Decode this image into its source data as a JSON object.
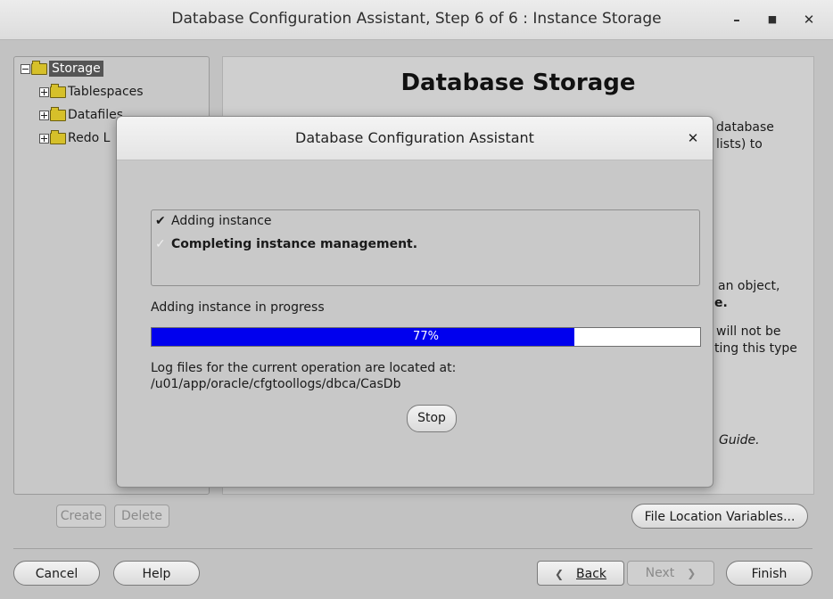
{
  "window": {
    "title": "Database Configuration Assistant, Step 6 of 6 : Instance Storage",
    "minimize": "–",
    "maximize": "■",
    "close": "✕"
  },
  "tree": {
    "root": "Storage",
    "items": [
      "Tablespaces",
      "Datafiles",
      "Redo L"
    ]
  },
  "content": {
    "heading": "Database Storage",
    "fragments": [
      "database",
      "lists) to",
      "an object,",
      "e.",
      "will not be",
      "ting this type",
      "Guide."
    ]
  },
  "tree_buttons": {
    "create": "Create",
    "delete": "Delete"
  },
  "file_location_button": "File Location Variables...",
  "footer": {
    "cancel": "Cancel",
    "help": "Help",
    "back": "Back",
    "next": "Next",
    "finish": "Finish",
    "back_icon": "chevron-left-icon",
    "next_icon": "chevron-right-icon"
  },
  "dialog": {
    "title": "Database Configuration Assistant",
    "close": "✕",
    "steps": [
      {
        "mark": "✔",
        "label": "Adding instance",
        "status": "done"
      },
      {
        "mark": "✓",
        "label": "Completing instance management.",
        "status": "in-progress"
      }
    ],
    "progress_label": "Adding instance in progress",
    "progress_value": 77,
    "progress_text": "77%",
    "progress_color": "#0000ee",
    "log_line1": "Log files for the current operation are located at:",
    "log_line2": "/u01/app/oracle/cfgtoollogs/dbca/CasDb",
    "stop": "Stop"
  }
}
